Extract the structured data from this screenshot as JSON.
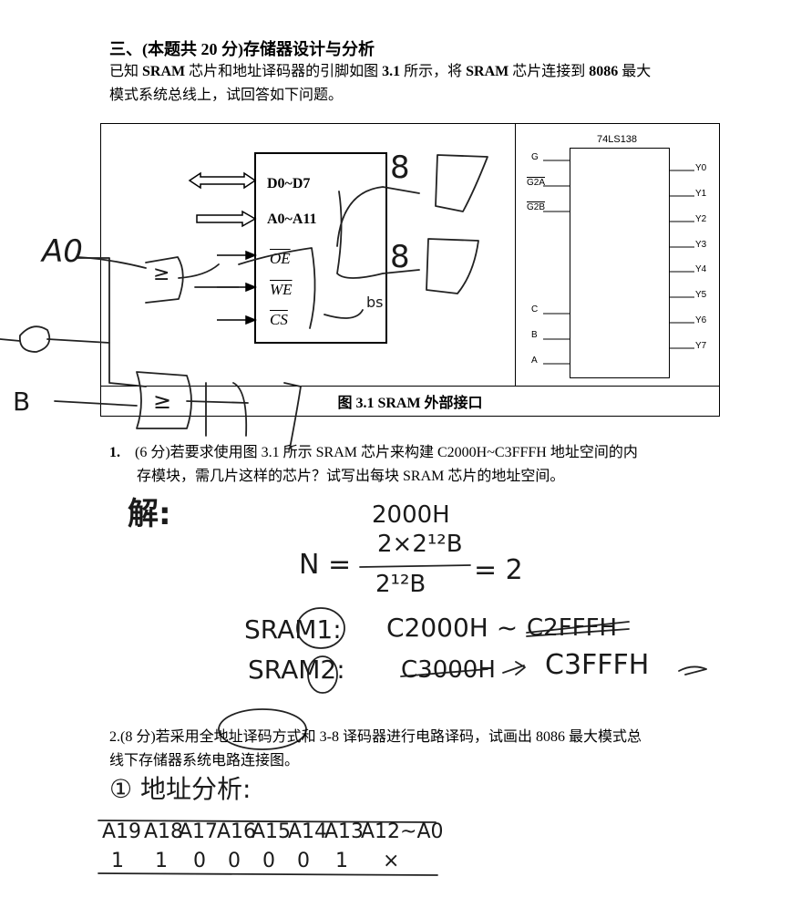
{
  "section_title": "三、(本题共 20 分)存储器设计与分析",
  "intro": {
    "line1_a": "已知 ",
    "line1_b": "SRAM",
    "line1_c": " 芯片和地址译码器的引脚如图 ",
    "line1_d": "3.1",
    "line1_e": " 所示，将 ",
    "line1_f": "SRAM",
    "line1_g": " 芯片连接到 ",
    "line1_h": "8086",
    "line1_i": " 最大",
    "line2": "模式系统总线上，试回答如下问题。"
  },
  "figure": {
    "caption": "图 3.1    SRAM 外部接口",
    "sram_pins": {
      "data": "D0~D7",
      "addr": "A0~A11",
      "oe": "OE",
      "we": "WE",
      "cs": "CS"
    },
    "decoder": {
      "title": "74LS138",
      "inputs_enable": [
        "G",
        "G2A",
        "G2B"
      ],
      "inputs_select": [
        "C",
        "B",
        "A"
      ],
      "outputs": [
        "Y0",
        "Y1",
        "Y2",
        "Y3",
        "Y4",
        "Y5",
        "Y6",
        "Y7"
      ]
    }
  },
  "q1": {
    "number": "1.",
    "line1": "(6 分)若要求使用图 3.1 所示 SRAM 芯片来构建 C2000H~C3FFFH 地址空间的内",
    "line2": "存模块，需几片这样的芯片？试写出每块 SRAM 芯片的地址空间。"
  },
  "q2": {
    "line1": "2.(8 分)若采用全地址译码方式和 3-8 译码器进行电路译码，试画出 8086 最大模式总",
    "line2": "线下存储器系统电路连接图。"
  },
  "handwriting": {
    "jie": "解:",
    "frac_top1": "2000H",
    "frac_top2": "2×2¹²B",
    "frac_bottom": "2¹²B",
    "n_eq": "N =",
    "frac_result": "= 2",
    "sram1_label": "SRAM1:",
    "sram1_range_start": "C2000H ~",
    "sram1_range_struck": "C2FFFH",
    "sram2_label": "SRAM2:",
    "sram2_range_struck": "C3000H",
    "sram2_range_end": "C3FFFH",
    "fig_a0": "A0",
    "fig_b": "B",
    "fig_8a": "8",
    "fig_8b": "8",
    "fig_or": "≥",
    "fig_or2": "≥",
    "fig_sram_note": "bs",
    "addr_title": "① 地址分析:",
    "addr_headers": [
      "A19",
      "A18",
      "A17",
      "A16",
      "A15",
      "A14",
      "A13",
      "A12~A0"
    ],
    "addr_values": [
      "1",
      "1",
      "0",
      "0",
      "0",
      "0",
      "1",
      "×"
    ]
  }
}
